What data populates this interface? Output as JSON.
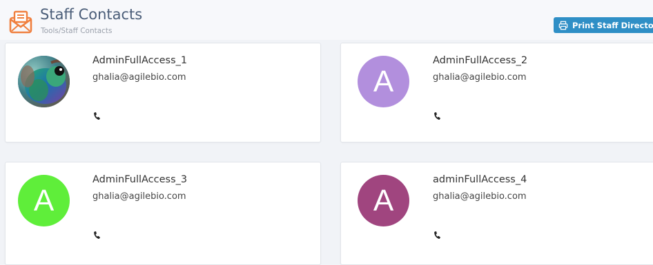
{
  "header": {
    "title": "Staff Contacts",
    "breadcrumb": "Tools/Staff Contacts",
    "icon": "envelope-icon",
    "icon_color": "#f07f3e",
    "print_button_label": "Print Staff Directory",
    "print_button_color": "#2f8fc6"
  },
  "contacts": [
    {
      "name": "AdminFullAccess_1",
      "email": "ghalia@agilebio.com",
      "avatar_type": "photo",
      "avatar_letter": ""
    },
    {
      "name": "AdminFullAccess_2",
      "email": "ghalia@agilebio.com",
      "avatar_type": "letter",
      "avatar_letter": "A",
      "avatar_color": "#b28fdd"
    },
    {
      "name": "AdminFullAccess_3",
      "email": "ghalia@agilebio.com",
      "avatar_type": "letter",
      "avatar_letter": "A",
      "avatar_color": "#5fee3a"
    },
    {
      "name": "adminFullAccess_4",
      "email": "ghalia@agilebio.com",
      "avatar_type": "letter",
      "avatar_letter": "A",
      "avatar_color": "#a0457f"
    }
  ]
}
